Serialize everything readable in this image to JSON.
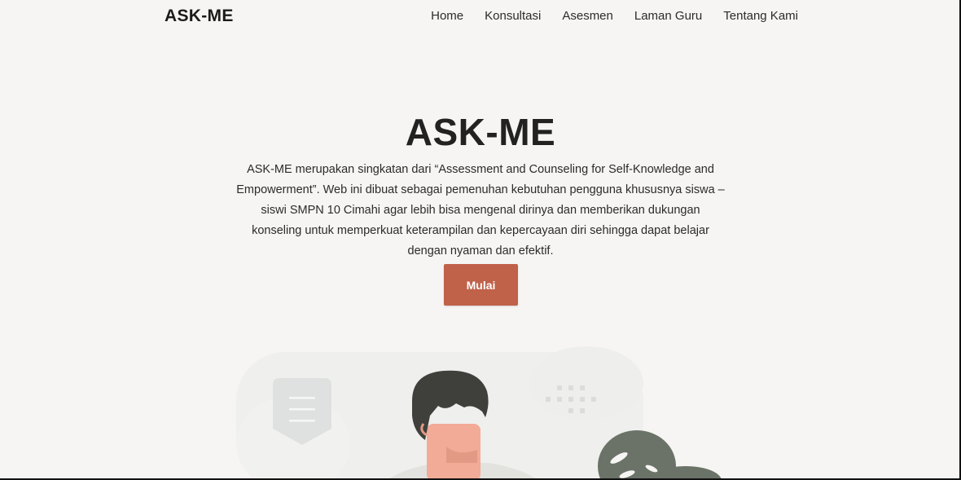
{
  "navbar": {
    "brand": "ASK-ME",
    "links": [
      {
        "label": "Home"
      },
      {
        "label": "Konsultasi"
      },
      {
        "label": "Asesmen"
      },
      {
        "label": "Laman Guru"
      },
      {
        "label": "Tentang Kami"
      }
    ]
  },
  "hero": {
    "title": "ASK-ME",
    "description": "ASK-ME merupakan singkatan dari “Assessment and Counseling for Self-Knowledge and Empowerment”. Web ini dibuat sebagai pemenuhan kebutuhan pengguna khususnya siswa – siswi SMPN 10 Cimahi agar lebih bisa mengenal dirinya dan memberikan dukungan konseling untuk memperkuat keterampilan dan kepercayaan diri sehingga dapat belajar dengan nyaman dan efektif.",
    "cta_label": "Mulai"
  },
  "illustration": {
    "icons": [
      "document-badge-icon",
      "dot-grid-icon",
      "person-figure",
      "plant-leaf-icon"
    ]
  },
  "colors": {
    "background": "#f6f5f3",
    "accent": "#c0614a",
    "text": "#1f1f1f",
    "hair": "#3f403c",
    "skin": "#f2ab96",
    "leaf": "#6b7368"
  }
}
